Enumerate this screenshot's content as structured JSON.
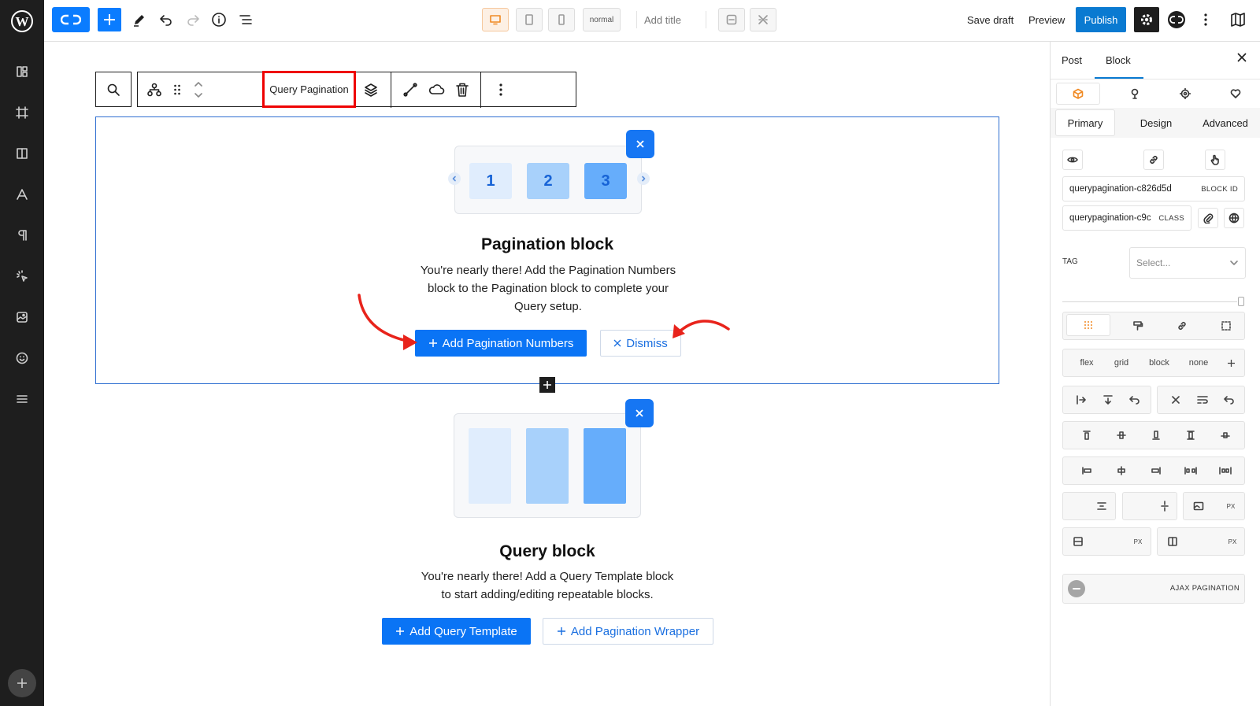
{
  "topbar": {
    "device_mode": "normal",
    "add_title": "Add title",
    "save_draft": "Save draft",
    "preview": "Preview",
    "publish": "Publish"
  },
  "toolbar": {
    "block_name": "Query Pagination"
  },
  "pagination_block": {
    "numbers": [
      "1",
      "2",
      "3"
    ],
    "title": "Pagination block",
    "description_lines": [
      "You're nearly there! Add the Pagination Numbers",
      "block to the Pagination block to complete your",
      "Query setup."
    ],
    "add_button": "Add Pagination Numbers",
    "dismiss_button": "Dismiss"
  },
  "query_block": {
    "title": "Query block",
    "description_lines": [
      "You're nearly there! Add a Query Template block",
      "to start adding/editing repeatable blocks."
    ],
    "add_template_button": "Add Query Template",
    "add_wrapper_button": "Add Pagination Wrapper"
  },
  "right_panel": {
    "tabs": [
      "Post",
      "Block"
    ],
    "active_tab": "Block",
    "section_tabs": [
      "Primary",
      "Design",
      "Advanced"
    ],
    "active_section": "Primary",
    "block_id_value": "querypagination-c826d5d",
    "block_id_label": "BLOCK ID",
    "class_value": "querypagination-c9c",
    "class_label": "CLASS",
    "tag_label": "TAG",
    "tag_placeholder": "Select...",
    "display_options": [
      "flex",
      "grid",
      "block",
      "none"
    ],
    "unit_px": "PX",
    "ajax_label": "AJAX PAGINATION"
  },
  "colors": {
    "accent": "#0a74f5",
    "publish": "#0a7ad1",
    "highlight": "#e00000",
    "device_active": "#f08a24",
    "num_light": "#e0edfd",
    "num_mid": "#a8d1fb",
    "num_dark": "#66adfb"
  }
}
